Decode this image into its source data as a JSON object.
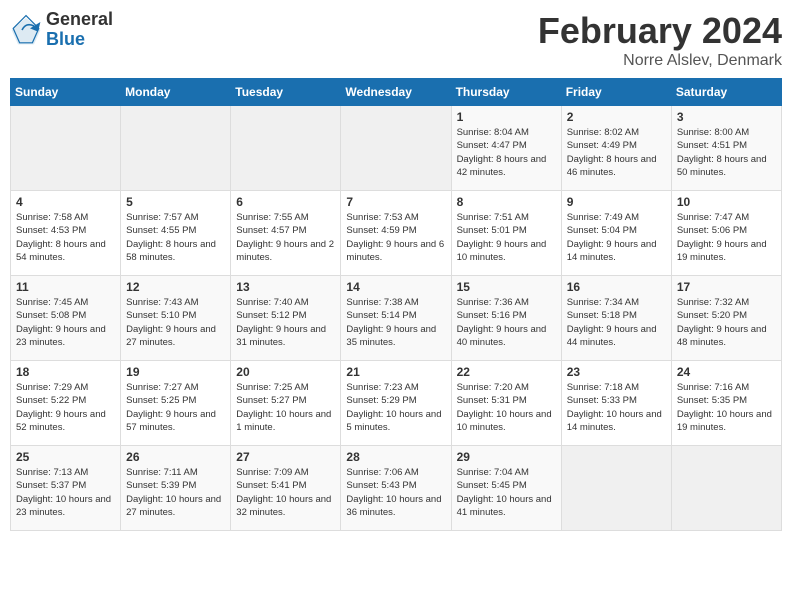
{
  "header": {
    "logo_general": "General",
    "logo_blue": "Blue",
    "month_year": "February 2024",
    "location": "Norre Alslev, Denmark"
  },
  "weekdays": [
    "Sunday",
    "Monday",
    "Tuesday",
    "Wednesday",
    "Thursday",
    "Friday",
    "Saturday"
  ],
  "weeks": [
    [
      {
        "day": "",
        "sunrise": "",
        "sunset": "",
        "daylight": ""
      },
      {
        "day": "",
        "sunrise": "",
        "sunset": "",
        "daylight": ""
      },
      {
        "day": "",
        "sunrise": "",
        "sunset": "",
        "daylight": ""
      },
      {
        "day": "",
        "sunrise": "",
        "sunset": "",
        "daylight": ""
      },
      {
        "day": "1",
        "sunrise": "Sunrise: 8:04 AM",
        "sunset": "Sunset: 4:47 PM",
        "daylight": "Daylight: 8 hours and 42 minutes."
      },
      {
        "day": "2",
        "sunrise": "Sunrise: 8:02 AM",
        "sunset": "Sunset: 4:49 PM",
        "daylight": "Daylight: 8 hours and 46 minutes."
      },
      {
        "day": "3",
        "sunrise": "Sunrise: 8:00 AM",
        "sunset": "Sunset: 4:51 PM",
        "daylight": "Daylight: 8 hours and 50 minutes."
      }
    ],
    [
      {
        "day": "4",
        "sunrise": "Sunrise: 7:58 AM",
        "sunset": "Sunset: 4:53 PM",
        "daylight": "Daylight: 8 hours and 54 minutes."
      },
      {
        "day": "5",
        "sunrise": "Sunrise: 7:57 AM",
        "sunset": "Sunset: 4:55 PM",
        "daylight": "Daylight: 8 hours and 58 minutes."
      },
      {
        "day": "6",
        "sunrise": "Sunrise: 7:55 AM",
        "sunset": "Sunset: 4:57 PM",
        "daylight": "Daylight: 9 hours and 2 minutes."
      },
      {
        "day": "7",
        "sunrise": "Sunrise: 7:53 AM",
        "sunset": "Sunset: 4:59 PM",
        "daylight": "Daylight: 9 hours and 6 minutes."
      },
      {
        "day": "8",
        "sunrise": "Sunrise: 7:51 AM",
        "sunset": "Sunset: 5:01 PM",
        "daylight": "Daylight: 9 hours and 10 minutes."
      },
      {
        "day": "9",
        "sunrise": "Sunrise: 7:49 AM",
        "sunset": "Sunset: 5:04 PM",
        "daylight": "Daylight: 9 hours and 14 minutes."
      },
      {
        "day": "10",
        "sunrise": "Sunrise: 7:47 AM",
        "sunset": "Sunset: 5:06 PM",
        "daylight": "Daylight: 9 hours and 19 minutes."
      }
    ],
    [
      {
        "day": "11",
        "sunrise": "Sunrise: 7:45 AM",
        "sunset": "Sunset: 5:08 PM",
        "daylight": "Daylight: 9 hours and 23 minutes."
      },
      {
        "day": "12",
        "sunrise": "Sunrise: 7:43 AM",
        "sunset": "Sunset: 5:10 PM",
        "daylight": "Daylight: 9 hours and 27 minutes."
      },
      {
        "day": "13",
        "sunrise": "Sunrise: 7:40 AM",
        "sunset": "Sunset: 5:12 PM",
        "daylight": "Daylight: 9 hours and 31 minutes."
      },
      {
        "day": "14",
        "sunrise": "Sunrise: 7:38 AM",
        "sunset": "Sunset: 5:14 PM",
        "daylight": "Daylight: 9 hours and 35 minutes."
      },
      {
        "day": "15",
        "sunrise": "Sunrise: 7:36 AM",
        "sunset": "Sunset: 5:16 PM",
        "daylight": "Daylight: 9 hours and 40 minutes."
      },
      {
        "day": "16",
        "sunrise": "Sunrise: 7:34 AM",
        "sunset": "Sunset: 5:18 PM",
        "daylight": "Daylight: 9 hours and 44 minutes."
      },
      {
        "day": "17",
        "sunrise": "Sunrise: 7:32 AM",
        "sunset": "Sunset: 5:20 PM",
        "daylight": "Daylight: 9 hours and 48 minutes."
      }
    ],
    [
      {
        "day": "18",
        "sunrise": "Sunrise: 7:29 AM",
        "sunset": "Sunset: 5:22 PM",
        "daylight": "Daylight: 9 hours and 52 minutes."
      },
      {
        "day": "19",
        "sunrise": "Sunrise: 7:27 AM",
        "sunset": "Sunset: 5:25 PM",
        "daylight": "Daylight: 9 hours and 57 minutes."
      },
      {
        "day": "20",
        "sunrise": "Sunrise: 7:25 AM",
        "sunset": "Sunset: 5:27 PM",
        "daylight": "Daylight: 10 hours and 1 minute."
      },
      {
        "day": "21",
        "sunrise": "Sunrise: 7:23 AM",
        "sunset": "Sunset: 5:29 PM",
        "daylight": "Daylight: 10 hours and 5 minutes."
      },
      {
        "day": "22",
        "sunrise": "Sunrise: 7:20 AM",
        "sunset": "Sunset: 5:31 PM",
        "daylight": "Daylight: 10 hours and 10 minutes."
      },
      {
        "day": "23",
        "sunrise": "Sunrise: 7:18 AM",
        "sunset": "Sunset: 5:33 PM",
        "daylight": "Daylight: 10 hours and 14 minutes."
      },
      {
        "day": "24",
        "sunrise": "Sunrise: 7:16 AM",
        "sunset": "Sunset: 5:35 PM",
        "daylight": "Daylight: 10 hours and 19 minutes."
      }
    ],
    [
      {
        "day": "25",
        "sunrise": "Sunrise: 7:13 AM",
        "sunset": "Sunset: 5:37 PM",
        "daylight": "Daylight: 10 hours and 23 minutes."
      },
      {
        "day": "26",
        "sunrise": "Sunrise: 7:11 AM",
        "sunset": "Sunset: 5:39 PM",
        "daylight": "Daylight: 10 hours and 27 minutes."
      },
      {
        "day": "27",
        "sunrise": "Sunrise: 7:09 AM",
        "sunset": "Sunset: 5:41 PM",
        "daylight": "Daylight: 10 hours and 32 minutes."
      },
      {
        "day": "28",
        "sunrise": "Sunrise: 7:06 AM",
        "sunset": "Sunset: 5:43 PM",
        "daylight": "Daylight: 10 hours and 36 minutes."
      },
      {
        "day": "29",
        "sunrise": "Sunrise: 7:04 AM",
        "sunset": "Sunset: 5:45 PM",
        "daylight": "Daylight: 10 hours and 41 minutes."
      },
      {
        "day": "",
        "sunrise": "",
        "sunset": "",
        "daylight": ""
      },
      {
        "day": "",
        "sunrise": "",
        "sunset": "",
        "daylight": ""
      }
    ]
  ]
}
